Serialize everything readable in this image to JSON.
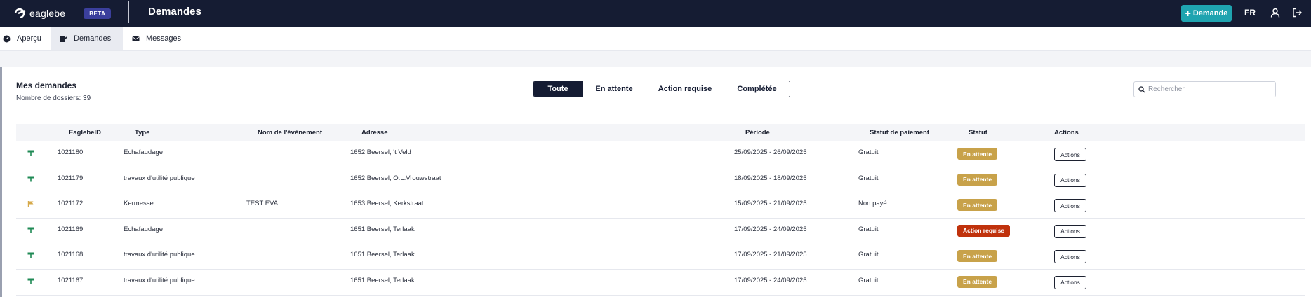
{
  "topbar": {
    "logo_text": "eaglebe",
    "beta_label": "BETA",
    "page_title": "Demandes",
    "new_request_label": "Demande",
    "language": "FR"
  },
  "subnav": {
    "items": [
      {
        "label": "Aperçu",
        "icon": "dashboard-icon"
      },
      {
        "label": "Demandes",
        "icon": "edit-document-icon"
      },
      {
        "label": "Messages",
        "icon": "envelope-icon"
      }
    ]
  },
  "card": {
    "title": "Mes demandes",
    "subtitle": "Nombre de dossiers: 39"
  },
  "filters": [
    "Toute",
    "En attente",
    "Action requise",
    "Complétée"
  ],
  "search": {
    "placeholder": "Rechercher",
    "value": ""
  },
  "table": {
    "headers": [
      "EaglebeID",
      "Type",
      "Nom de l'évènement",
      "Adresse",
      "Période",
      "Statut de paiement",
      "Statut",
      "Actions"
    ],
    "rows": [
      {
        "icon": "sign-icon",
        "icon_color": "#1f8a55",
        "id": "1021180",
        "type": "Echafaudage",
        "event": "",
        "address": "1652 Beersel, 't Veld",
        "period": "25/09/2025 - 26/09/2025",
        "payment": "Gratuit",
        "status": "En attente",
        "status_color": "#c8a24a",
        "action": "Actions"
      },
      {
        "icon": "sign-icon",
        "icon_color": "#1f8a55",
        "id": "1021179",
        "type": "travaux d'utilité publique",
        "event": "",
        "address": "1652 Beersel, O.L.Vrouwstraat",
        "period": "18/09/2025 - 18/09/2025",
        "payment": "Gratuit",
        "status": "En attente",
        "status_color": "#c8a24a",
        "action": "Actions"
      },
      {
        "icon": "flag-icon",
        "icon_color": "#d6a94a",
        "id": "1021172",
        "type": "Kermesse",
        "event": "TEST EVA",
        "address": "1653 Beersel, Kerkstraat",
        "period": "15/09/2025 - 21/09/2025",
        "payment": "Non payé",
        "status": "En attente",
        "status_color": "#c8a24a",
        "action": "Actions"
      },
      {
        "icon": "sign-icon",
        "icon_color": "#1f8a55",
        "id": "1021169",
        "type": "Echafaudage",
        "event": "",
        "address": "1651 Beersel, Terlaak",
        "period": "17/09/2025 - 24/09/2025",
        "payment": "Gratuit",
        "status": "Action requise",
        "status_color": "#c0320c",
        "action": "Actions"
      },
      {
        "icon": "sign-icon",
        "icon_color": "#1f8a55",
        "id": "1021168",
        "type": "travaux d'utilité publique",
        "event": "",
        "address": "1651 Beersel, Terlaak",
        "period": "17/09/2025 - 21/09/2025",
        "payment": "Gratuit",
        "status": "En attente",
        "status_color": "#c8a24a",
        "action": "Actions"
      },
      {
        "icon": "sign-icon",
        "icon_color": "#1f8a55",
        "id": "1021167",
        "type": "travaux d'utilité publique",
        "event": "",
        "address": "1651 Beersel, Terlaak",
        "period": "17/09/2025 - 24/09/2025",
        "payment": "Gratuit",
        "status": "En attente",
        "status_color": "#c8a24a",
        "action": "Actions"
      }
    ]
  },
  "colors": {
    "navy": "#151c33",
    "teal": "#1fa4b0",
    "pending": "#c8a24a",
    "action_required": "#c0320c"
  }
}
